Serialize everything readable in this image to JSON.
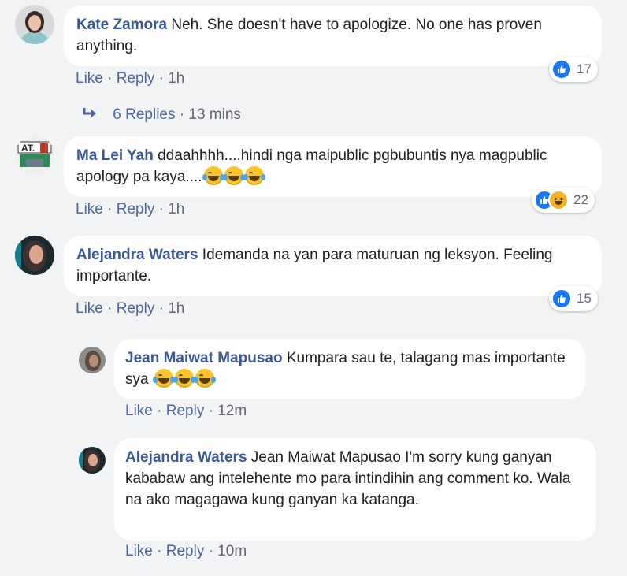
{
  "colors": {
    "author": "#385898",
    "link": "#4b67a1",
    "meta": "#606770",
    "bg": "#f2f3f5",
    "like_blue": "#1877f2"
  },
  "comments": [
    {
      "author": "Kate Zamora",
      "text": "Neh. She doesn't have to apologize. No one has proven anything.",
      "like_label": "Like",
      "reply_label": "Reply",
      "separator": "·",
      "time": "1h",
      "reaction_count": "17",
      "reactions": [
        "like-icon"
      ]
    },
    {
      "author": "Ma Lei Yah",
      "text": "ddaahhhh....hindi nga maipublic pgbubuntis nya magpublic apology pa kaya....",
      "emojis": [
        "laughing-tears-emoji",
        "laughing-tears-emoji",
        "laughing-tears-emoji"
      ],
      "like_label": "Like",
      "reply_label": "Reply",
      "separator": "·",
      "time": "1h",
      "reaction_count": "22",
      "reactions": [
        "like-icon",
        "haha-icon"
      ]
    },
    {
      "author": "Alejandra Waters",
      "text": "Idemanda na yan para maturuan ng leksyon. Feeling importante.",
      "like_label": "Like",
      "reply_label": "Reply",
      "separator": "·",
      "time": "1h",
      "reaction_count": "15",
      "reactions": [
        "like-icon"
      ]
    }
  ],
  "replies_link": {
    "label": "6 Replies",
    "separator": "·",
    "time": "13 mins",
    "icon": "reply-arrow-icon"
  },
  "replies": [
    {
      "author": "Jean Maiwat Mapusao",
      "text": "Kumpara sau te, talagang mas importante sya",
      "emojis": [
        "laughing-tears-emoji",
        "laughing-tears-emoji",
        "laughing-tears-emoji"
      ],
      "like_label": "Like",
      "reply_label": "Reply",
      "separator": "·",
      "time": "12m"
    },
    {
      "author": "Alejandra Waters",
      "text": "Jean Maiwat Mapusao I'm sorry kung ganyan kababaw ang intelehente mo para intindihin ang comment ko. Wala na ako magagawa kung ganyan ka katanga.",
      "like_label": "Like",
      "reply_label": "Reply",
      "separator": "·",
      "time": "10m"
    }
  ]
}
